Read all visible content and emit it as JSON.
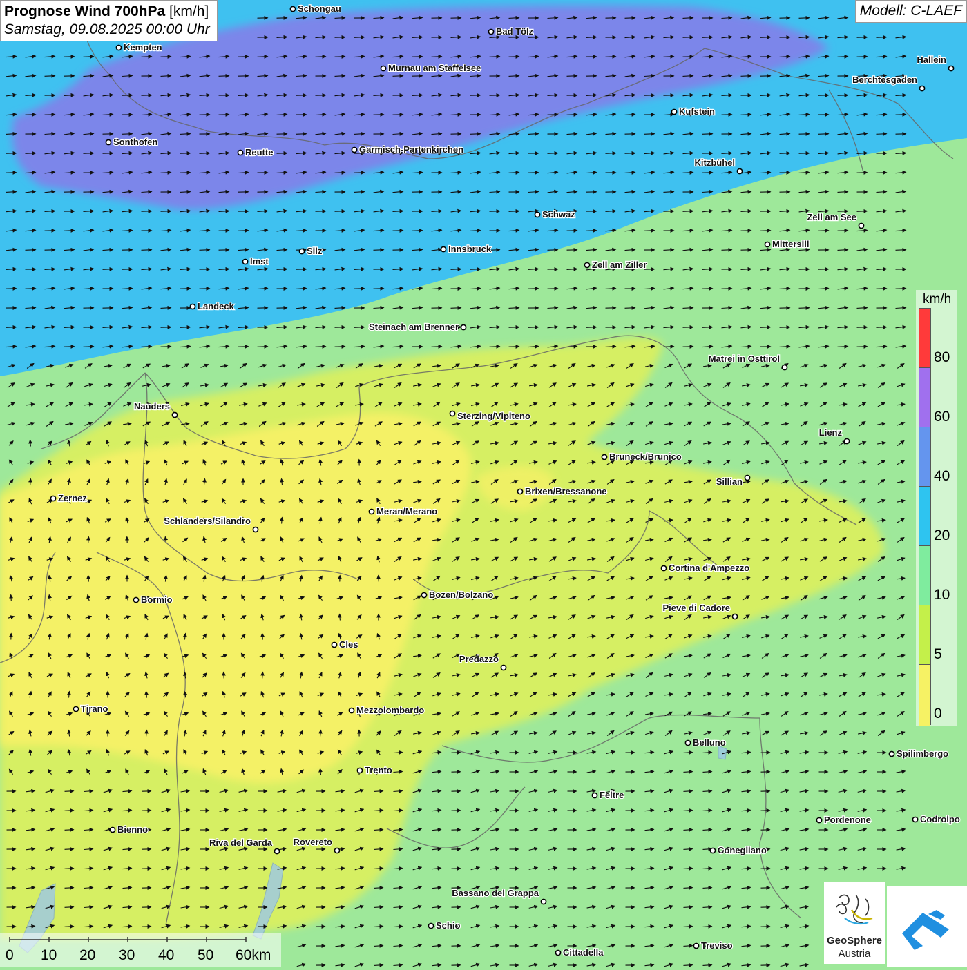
{
  "header": {
    "title_bold": "Prognose Wind 700hPa",
    "title_unit": "[km/h]",
    "datetime": "Samstag, 09.08.2025 00:00 Uhr",
    "model": "Modell: C-LAEF"
  },
  "legend": {
    "unit": "km/h",
    "labels": [
      "80",
      "60",
      "40",
      "20",
      "10",
      "5",
      "0"
    ],
    "colors": [
      "#ff3a3a",
      "#a070ee",
      "#6495ee",
      "#2ec4f0",
      "#7fec9e",
      "#c4f04a",
      "#f6f264"
    ]
  },
  "scalebar": {
    "labels": [
      "0",
      "10",
      "20",
      "30",
      "40",
      "50",
      "60km"
    ]
  },
  "logos": {
    "geosphere_line1": "GeoSphere",
    "geosphere_line2": "Austria"
  },
  "places": [
    {
      "name": "Schongau"
    },
    {
      "name": "Bad Tölz"
    },
    {
      "name": "Kempten"
    },
    {
      "name": "Murnau am Staffelsee"
    },
    {
      "name": "Hallein"
    },
    {
      "name": "Berchtesgaden"
    },
    {
      "name": "Kufstein"
    },
    {
      "name": "Sonthofen"
    },
    {
      "name": "Reutte"
    },
    {
      "name": "Garmisch-Partenkirchen"
    },
    {
      "name": "Kitzbühel"
    },
    {
      "name": "Schwaz"
    },
    {
      "name": "Zell am See"
    },
    {
      "name": "Mittersill"
    },
    {
      "name": "Imst"
    },
    {
      "name": "Silz"
    },
    {
      "name": "Innsbruck"
    },
    {
      "name": "Zell am Ziller"
    },
    {
      "name": "Landeck"
    },
    {
      "name": "Steinach am Brenner"
    },
    {
      "name": "Matrei in Osttirol"
    },
    {
      "name": "Nauders"
    },
    {
      "name": "Sterzing/Vipiteno"
    },
    {
      "name": "Lienz"
    },
    {
      "name": "Bruneck/Brunico"
    },
    {
      "name": "Sillian"
    },
    {
      "name": "Zernez"
    },
    {
      "name": "Brixen/Bressanone"
    },
    {
      "name": "Meran/Merano"
    },
    {
      "name": "Schlanders/Silandro"
    },
    {
      "name": "Cortina d'Ampezzo"
    },
    {
      "name": "Bozen/Bolzano"
    },
    {
      "name": "Bormio"
    },
    {
      "name": "Pieve di Cadore"
    },
    {
      "name": "Cles"
    },
    {
      "name": "Predazzo"
    },
    {
      "name": "Tirano"
    },
    {
      "name": "Mezzolombardo"
    },
    {
      "name": "Belluno"
    },
    {
      "name": "Spilimbergo"
    },
    {
      "name": "Trento"
    },
    {
      "name": "Feltre"
    },
    {
      "name": "Bienno"
    },
    {
      "name": "Pordenone"
    },
    {
      "name": "Codroipo"
    },
    {
      "name": "Riva del Garda"
    },
    {
      "name": "Rovereto"
    },
    {
      "name": "Conegliano"
    },
    {
      "name": "Bassano del Grappa"
    },
    {
      "name": "Schio"
    },
    {
      "name": "Treviso"
    },
    {
      "name": "Cittadella"
    }
  ]
}
